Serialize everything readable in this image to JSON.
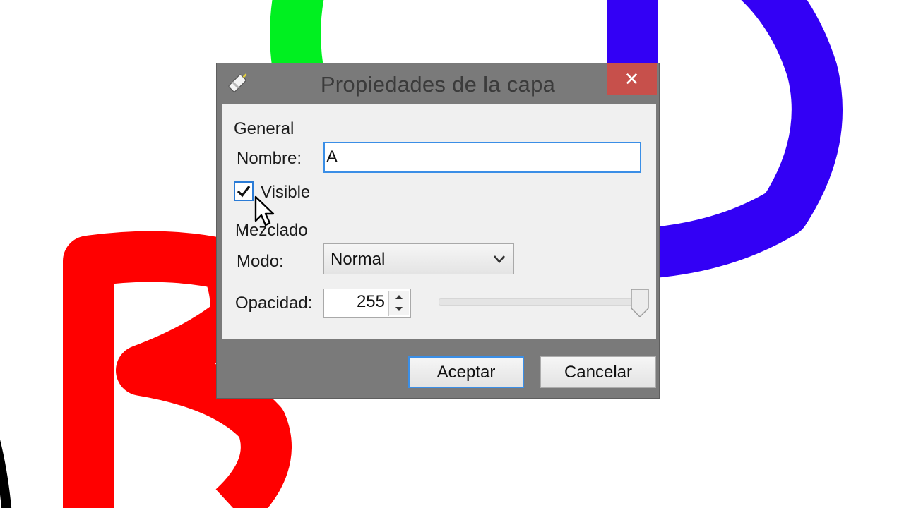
{
  "canvas": {
    "strokes": [
      {
        "color": "#00f020",
        "label": "green-stroke"
      },
      {
        "color": "#3300f5",
        "label": "blue-letter-d"
      },
      {
        "color": "#ff0000",
        "label": "red-letter-b"
      }
    ]
  },
  "dialog": {
    "title": "Propiedades de la capa",
    "icon": "layer-properties-icon",
    "close_label": "✕",
    "general_heading": "General",
    "name_label": "Nombre:",
    "name_value": "A",
    "visible_label": "Visible",
    "visible_checked": true,
    "blend_heading": "Mezclado",
    "mode_label": "Modo:",
    "mode_value": "Normal",
    "opacity_label": "Opacidad:",
    "opacity_value": "255",
    "opacity_slider_fraction": 1.0,
    "ok_label": "Aceptar",
    "cancel_label": "Cancelar"
  },
  "colors": {
    "accent": "#3a8ee6",
    "close_button": "#c7504b",
    "dialog_frame": "#7a7a7a"
  }
}
